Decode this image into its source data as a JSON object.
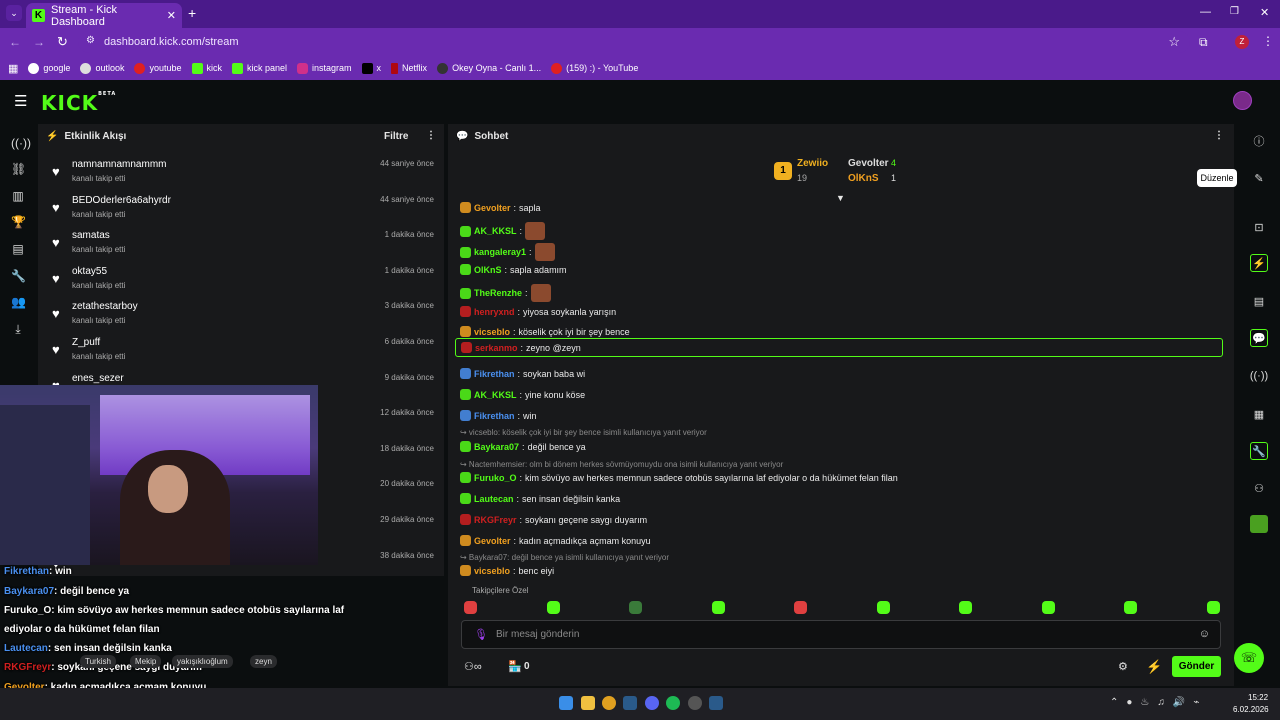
{
  "browser": {
    "tab_title": "Stream - Kick Dashboard",
    "url": "dashboard.kick.com/stream",
    "profile_initial": "Z",
    "bookmarks": [
      "google",
      "outlook",
      "youtube",
      "kick",
      "kick panel",
      "instagram",
      "x",
      "Netflix",
      "Okey Oyna - Canlı 1...",
      "(159) :) - YouTube"
    ]
  },
  "header": {
    "logo": "KICK",
    "beta": "BETA"
  },
  "activity": {
    "title": "Etkinlik Akışı",
    "filter_label": "Filtre",
    "items": [
      {
        "name": "namnamnamnammm",
        "sub": "kanalı takip etti",
        "time": "44 saniye önce"
      },
      {
        "name": "BEDOderler6a6ahyrdr",
        "sub": "kanalı takip etti",
        "time": "44 saniye önce"
      },
      {
        "name": "samatas",
        "sub": "kanalı takip etti",
        "time": "1 dakika önce"
      },
      {
        "name": "oktay55",
        "sub": "kanalı takip etti",
        "time": "1 dakika önce"
      },
      {
        "name": "zetathestarboy",
        "sub": "kanalı takip etti",
        "time": "3 dakika önce"
      },
      {
        "name": "Z_puff",
        "sub": "kanalı takip etti",
        "time": "6 dakika önce"
      },
      {
        "name": "enes_sezer",
        "sub": "",
        "time": "9 dakika önce"
      },
      {
        "name": "",
        "sub": "",
        "time": "12 dakika önce"
      },
      {
        "name": "",
        "sub": "",
        "time": "18 dakika önce"
      },
      {
        "name": "",
        "sub": "",
        "time": "20 dakika önce"
      },
      {
        "name": "",
        "sub": "",
        "time": "29 dakika önce"
      },
      {
        "name": "",
        "sub": "",
        "time": "38 dakika önce"
      }
    ]
  },
  "chat": {
    "title": "Sohbet",
    "leaderboard": {
      "first": {
        "rank": "1",
        "name": "Zewiio",
        "count": "19"
      },
      "second": {
        "name": "Gevolter",
        "count": "4"
      },
      "third": {
        "name": "OlKnS",
        "count": "1"
      }
    },
    "messages": [
      {
        "user": "Gevolter",
        "color": "#f0a020",
        "text": "sapla"
      },
      {
        "user": "AK_KKSL",
        "color": "#53fc18",
        "text": ""
      },
      {
        "user": "kangaleray1",
        "color": "#53fc18",
        "text": ""
      },
      {
        "user": "OlKnS",
        "color": "#53fc18",
        "text": "sapla adamım"
      },
      {
        "user": "TheRenzhe",
        "color": "#53fc18",
        "text": ""
      },
      {
        "user": "henryxnd",
        "color": "#d02020",
        "text": "yiyosa soykanla yarışın"
      },
      {
        "user": "vicseblo",
        "color": "#f0a020",
        "text": "köselik çok iyi bir şey bence"
      },
      {
        "user": "serkanmo",
        "color": "#d02020",
        "text": "zeyno @zeyn"
      },
      {
        "user": "Fikrethan",
        "color": "#4a90f0",
        "text": "soykan baba wi"
      },
      {
        "user": "AK_KKSL",
        "color": "#53fc18",
        "text": "yine konu köse"
      },
      {
        "user": "Fikrethan",
        "color": "#4a90f0",
        "text": "win"
      },
      {
        "user": "Baykara07",
        "color": "#53fc18",
        "text": "değil bence ya",
        "reply": "vicseblo: köselik çok iyi bir şey bence isimli kullanıcıya yanıt veriyor"
      },
      {
        "user": "Furuko_O",
        "color": "#53fc18",
        "text": "kim sövüyo aw herkes memnun sadece otobüs sayılarına laf ediyolar o da hükümet felan filan",
        "reply": "Nactemhemsier: olm bi dönem herkes sövmüyomuydu ona  isimli kullanıcıya yanıt veriyor"
      },
      {
        "user": "Lautecan",
        "color": "#53fc18",
        "text": "sen insan değilsin kanka"
      },
      {
        "user": "RKGFreyr",
        "color": "#d02020",
        "text": "soykanı geçene saygı duyarım"
      },
      {
        "user": "Gevolter",
        "color": "#f0a020",
        "text": "kadın açmadıkça açmam konuyu"
      },
      {
        "user": "vicseblo",
        "color": "#f0a020",
        "text": "benc eiyi",
        "reply": "Baykara07: değil bence ya isimli kullanıcıya yanıt veriyor"
      }
    ],
    "emote_label": "Takipçilere Özel",
    "input_placeholder": "Bir mesaj gönderin",
    "send_label": "Gönder",
    "bottom_count": "0"
  },
  "tooltip": "Düzenle",
  "overlay": {
    "lines": [
      {
        "user": "Fikrethan",
        "text": ": win"
      },
      {
        "user": "Baykara07",
        "text": ": değil bence ya"
      },
      {
        "user": "Furuko_O",
        "text": ": kim sövüyo aw herkes memnun sadece otobüs sayılarına laf"
      },
      {
        "user": "",
        "text": "ediyolar o da hükümet felan filan"
      },
      {
        "user": "Lautecan",
        "text": ": sen insan değilsin kanka"
      },
      {
        "user": "RKGFreyr",
        "text": ": soykanı geçene saygı duyarım"
      },
      {
        "user": "Gevolter",
        "text": ": kadın açmadıkça açmam konuyu"
      },
      {
        "user": "vicseblo",
        "text": ": benc eiyi"
      }
    ],
    "tags": [
      "Turkish",
      "Mekip",
      "yakışıklıoğlum",
      "zeyn"
    ]
  },
  "taskbar": {
    "time": "15:22",
    "date": "6.02.2026"
  },
  "colors": {
    "accent": "#53fc18",
    "chrome": "#6a2bb0",
    "panel": "#18191b"
  }
}
